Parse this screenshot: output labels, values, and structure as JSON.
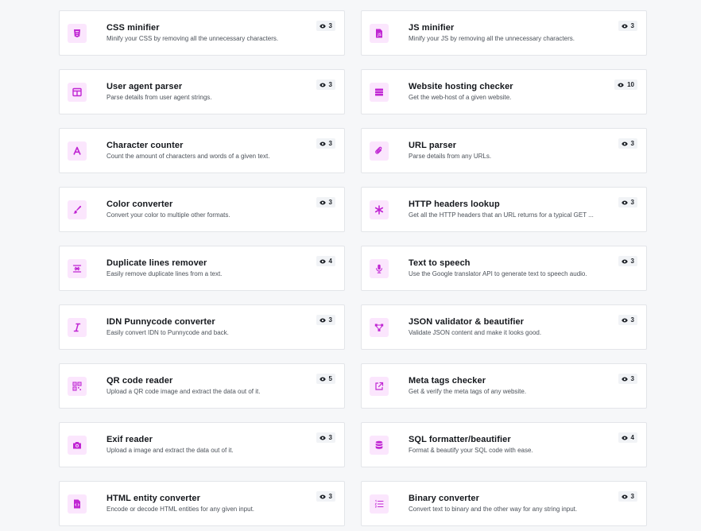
{
  "accent_color": "#c026d3",
  "icon_bg_color": "#fbe6fd",
  "tools": [
    {
      "title": "CSS minifier",
      "description": "Minify your CSS by removing all the unnecessary characters.",
      "views": "3",
      "icon": "css-file-icon"
    },
    {
      "title": "JS minifier",
      "description": "Minify your JS by removing all the unnecessary characters.",
      "views": "3",
      "icon": "js-file-icon"
    },
    {
      "title": "User agent parser",
      "description": "Parse details from user agent strings.",
      "views": "3",
      "icon": "columns-icon"
    },
    {
      "title": "Website hosting checker",
      "description": "Get the web-host of a given website.",
      "views": "10",
      "icon": "server-icon"
    },
    {
      "title": "Character counter",
      "description": "Count the amount of characters and words of a given text.",
      "views": "3",
      "icon": "letter-a-icon"
    },
    {
      "title": "URL parser",
      "description": "Parse details from any URLs.",
      "views": "3",
      "icon": "paperclip-icon"
    },
    {
      "title": "Color converter",
      "description": "Convert your color to multiple other formats.",
      "views": "3",
      "icon": "paintbrush-icon"
    },
    {
      "title": "HTTP headers lookup",
      "description": "Get all the HTTP headers that an URL returns for a typical GET ...",
      "views": "3",
      "icon": "asterisk-icon"
    },
    {
      "title": "Duplicate lines remover",
      "description": "Easily remove duplicate lines from a text.",
      "views": "4",
      "icon": "remove-lines-icon"
    },
    {
      "title": "Text to speech",
      "description": "Use the Google translator API to generate text to speech audio.",
      "views": "3",
      "icon": "microphone-icon"
    },
    {
      "title": "IDN Punnycode converter",
      "description": "Easily convert IDN to Punnycode and back.",
      "views": "3",
      "icon": "italic-icon"
    },
    {
      "title": "JSON validator & beautifier",
      "description": "Validate JSON content and make it looks good.",
      "views": "3",
      "icon": "network-icon"
    },
    {
      "title": "QR code reader",
      "description": "Upload a QR code image and extract the data out of it.",
      "views": "5",
      "icon": "qr-code-icon"
    },
    {
      "title": "Meta tags checker",
      "description": "Get & verify the meta tags of any website.",
      "views": "3",
      "icon": "external-link-icon"
    },
    {
      "title": "Exif reader",
      "description": "Upload a image and extract the data out of it.",
      "views": "3",
      "icon": "camera-icon"
    },
    {
      "title": "SQL formatter/beautifier",
      "description": "Format & beautify your SQL code with ease.",
      "views": "4",
      "icon": "database-icon"
    },
    {
      "title": "HTML entity converter",
      "description": "Encode or decode HTML entities for any given input.",
      "views": "3",
      "icon": "code-file-icon"
    },
    {
      "title": "Binary converter",
      "description": "Convert text to binary and the other way for any string input.",
      "views": "3",
      "icon": "numbered-list-icon"
    }
  ]
}
